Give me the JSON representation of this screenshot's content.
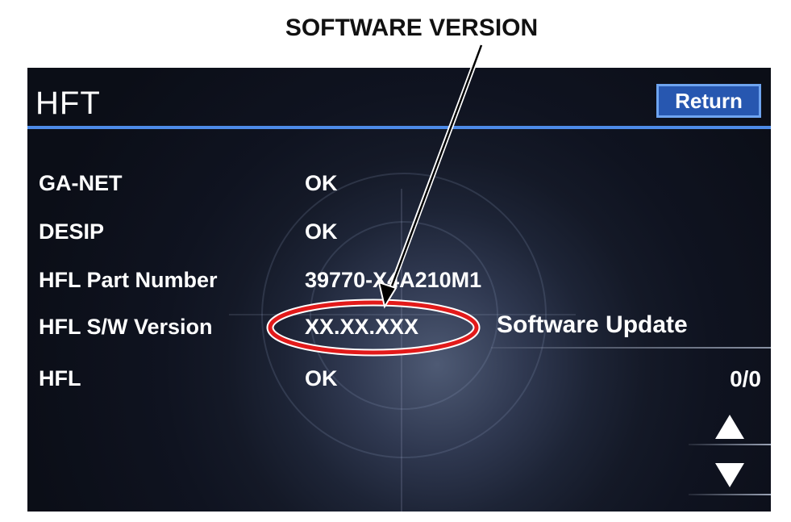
{
  "annotation": {
    "callout_label": "SOFTWARE VERSION"
  },
  "screen": {
    "title": "HFT",
    "return_label": "Return",
    "rows": [
      {
        "label": "GA-NET",
        "value": "OK"
      },
      {
        "label": "DESIP",
        "value": "OK"
      },
      {
        "label": "HFL Part Number",
        "value": "39770-X4A210M1"
      },
      {
        "label": "HFL S/W Version",
        "value": "XX.XX.XXX"
      },
      {
        "label": "HFL",
        "value": "OK"
      }
    ],
    "software_update_label": "Software Update",
    "page_count": "0/0",
    "icons": {
      "up": "triangle-up-icon",
      "down": "triangle-down-icon"
    },
    "colors": {
      "accent": "#4d8be8",
      "return_button_fill": "#2757b0",
      "highlight_ellipse": "#e21a1a"
    }
  }
}
